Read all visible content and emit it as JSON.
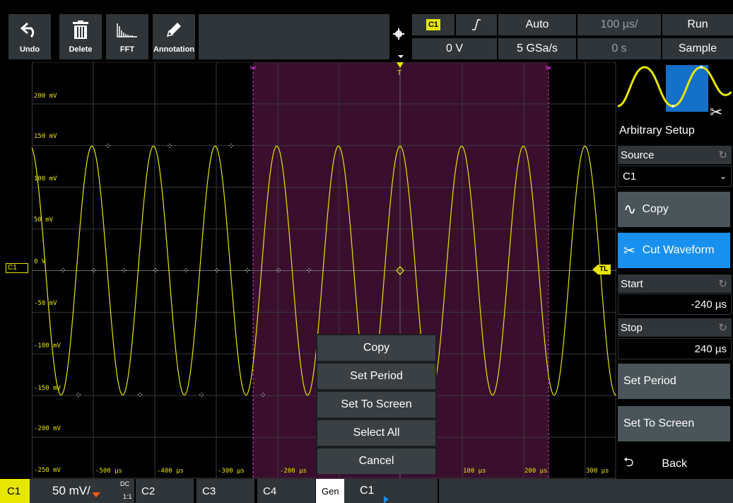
{
  "toolbar": {
    "undo_label": "Undo",
    "delete_label": "Delete",
    "fft_label": "FFT",
    "annotation_label": "Annotation"
  },
  "trigger": {
    "source": "C1",
    "slope_icon": "rising-edge-icon",
    "mode": "Auto",
    "timebase": "100 µs/",
    "run_state": "Run",
    "level": "0 V",
    "sample_rate": "5 GSa/s",
    "offset": "0 s",
    "acq_mode": "Sample"
  },
  "axis": {
    "y_labels": [
      "200 mV",
      "150 mV",
      "100 mV",
      "50 mV",
      "0 V",
      "-50 mV",
      "-100 mV",
      "-150 mV",
      "-200 mV",
      "-250 mV"
    ],
    "x_labels": [
      "-500 µs",
      "-400 µs",
      "-300 µs",
      "-200 µs",
      "100 µs",
      "200 µs",
      "300 µs"
    ],
    "channel_marker": "C1",
    "trigger_level_marker": "TL"
  },
  "context_menu": {
    "items": [
      "Copy",
      "Set Period",
      "Set To Screen",
      "Select All",
      "Cancel"
    ]
  },
  "panel": {
    "title": "Arbitrary Setup",
    "source_label": "Source",
    "source_value": "C1",
    "copy_label": "Copy",
    "cut_label": "Cut Waveform",
    "start_label": "Start",
    "start_value": "-240 µs",
    "stop_label": "Stop",
    "stop_value": "240 µs",
    "set_period_label": "Set Period",
    "set_to_screen_label": "Set To Screen",
    "back_label": "Back"
  },
  "bottom": {
    "c1_label": "C1",
    "c1_scale": "50 mV/",
    "c1_coupling": "DC",
    "c1_coupling_sub": "1:1",
    "c2_label": "C2",
    "c3_label": "C3",
    "c4_label": "C4",
    "gen_label": "Gen",
    "gen_source": "C1"
  },
  "colors": {
    "trace": "#e6e600",
    "selection": "#3a0f2e",
    "accent": "#1890f0",
    "cursor": "#e040e0"
  }
}
